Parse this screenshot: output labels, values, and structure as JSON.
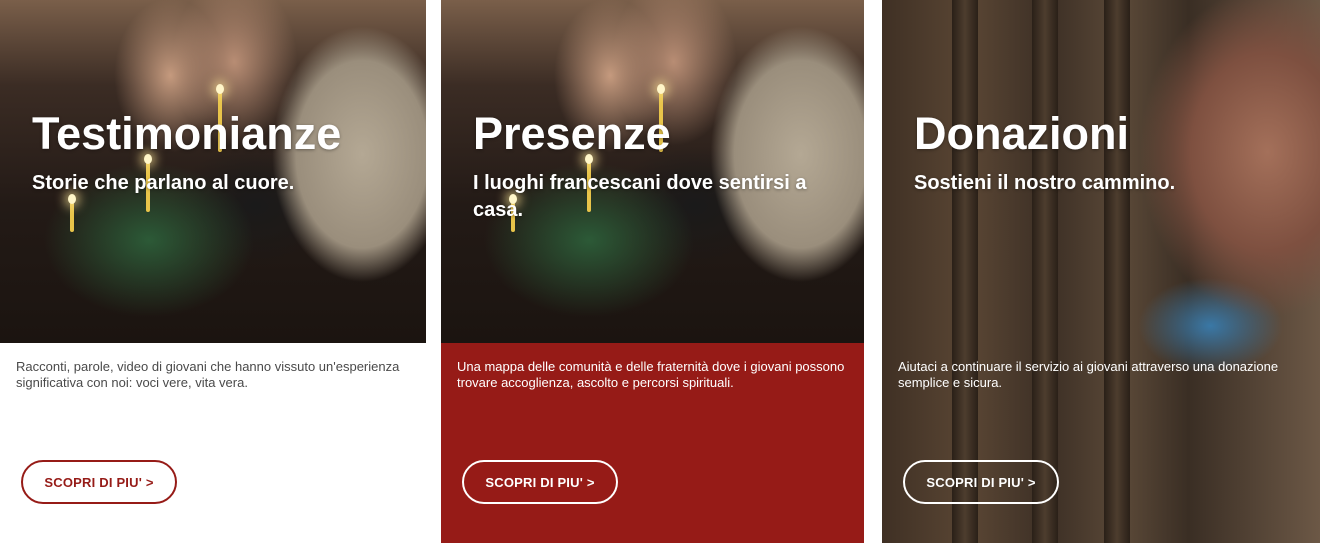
{
  "cards": [
    {
      "title": "Testimonianze",
      "subtitle": "Storie che parlano al cuore.",
      "description": "Racconti, parole, video di giovani che hanno vissuto un'esperienza significativa con noi: voci vere, vita vera.",
      "cta_label": "SCOPRI DI PIU' >"
    },
    {
      "title": "Presenze",
      "subtitle": "I luoghi francescani dove sentirsi a casa.",
      "description": "Una mappa delle comunità e delle fraternità dove i giovani possono trovare accoglienza, ascolto e percorsi spirituali.",
      "cta_label": "SCOPRI DI PIU' >"
    },
    {
      "title": "Donazioni",
      "subtitle": "Sostieni il nostro cammino.",
      "description": "Aiutaci a continuare il servizio ai giovani attraverso una donazione semplice e sicura.",
      "cta_label": "SCOPRI DI PIU' >"
    }
  ],
  "colors": {
    "accent": "#961b17",
    "text_dark": "#4a4a4a",
    "white": "#ffffff"
  }
}
